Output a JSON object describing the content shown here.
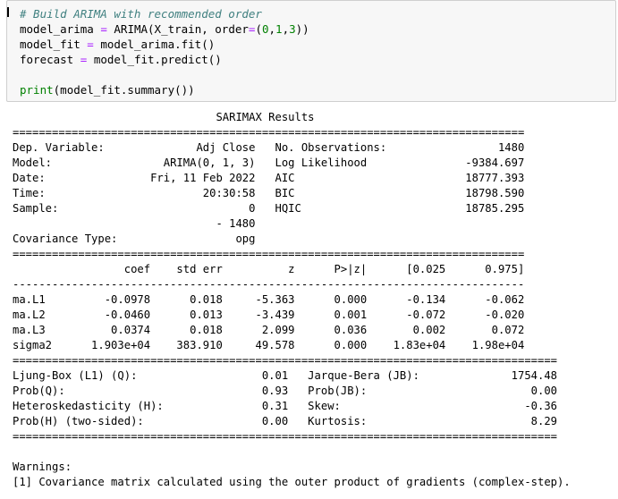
{
  "code_cell": {
    "comment": "# Build ARIMA with recommended order",
    "line1": {
      "lhs": "model_arima",
      "eq": "=",
      "call": "ARIMA(X_train, order",
      "eq2": "=",
      "open": "(",
      "n0": "0",
      "c1": ",",
      "n1": "1",
      "c2": ",",
      "n3": "3",
      "close": "))"
    },
    "line2": {
      "lhs": "model_fit",
      "eq": "=",
      "rhs": "model_arima.fit()"
    },
    "line3": {
      "lhs": "forecast",
      "eq": "=",
      "rhs": "model_fit.predict()"
    },
    "line5": {
      "fn": "print",
      "rest": "(model_fit.summary())"
    }
  },
  "output": {
    "lines": [
      "                               SARIMAX Results                                ",
      "==============================================================================",
      "Dep. Variable:              Adj Close   No. Observations:                 1480",
      "Model:                 ARIMA(0, 1, 3)   Log Likelihood               -9384.697",
      "Date:                Fri, 11 Feb 2022   AIC                          18777.393",
      "Time:                        20:30:58   BIC                          18798.590",
      "Sample:                             0   HQIC                         18785.295",
      "                               - 1480                                         ",
      "Covariance Type:                  opg                                         ",
      "==============================================================================",
      "                 coef    std err          z      P>|z|      [0.025      0.975]",
      "------------------------------------------------------------------------------",
      "ma.L1         -0.0978      0.018     -5.363      0.000      -0.134      -0.062",
      "ma.L2         -0.0460      0.013     -3.439      0.001      -0.072      -0.020",
      "ma.L3          0.0374      0.018      2.099      0.036       0.002       0.072",
      "sigma2      1.903e+04    383.910     49.578      0.000    1.83e+04    1.98e+04",
      "===================================================================================",
      "Ljung-Box (L1) (Q):                   0.01   Jarque-Bera (JB):              1754.48",
      "Prob(Q):                              0.93   Prob(JB):                         0.00",
      "Heteroskedasticity (H):               0.31   Skew:                            -0.36",
      "Prob(H) (two-sided):                  0.00   Kurtosis:                         8.29",
      "===================================================================================",
      "",
      "Warnings:",
      "[1] Covariance matrix calculated using the outer product of gradients (complex-step)."
    ]
  }
}
